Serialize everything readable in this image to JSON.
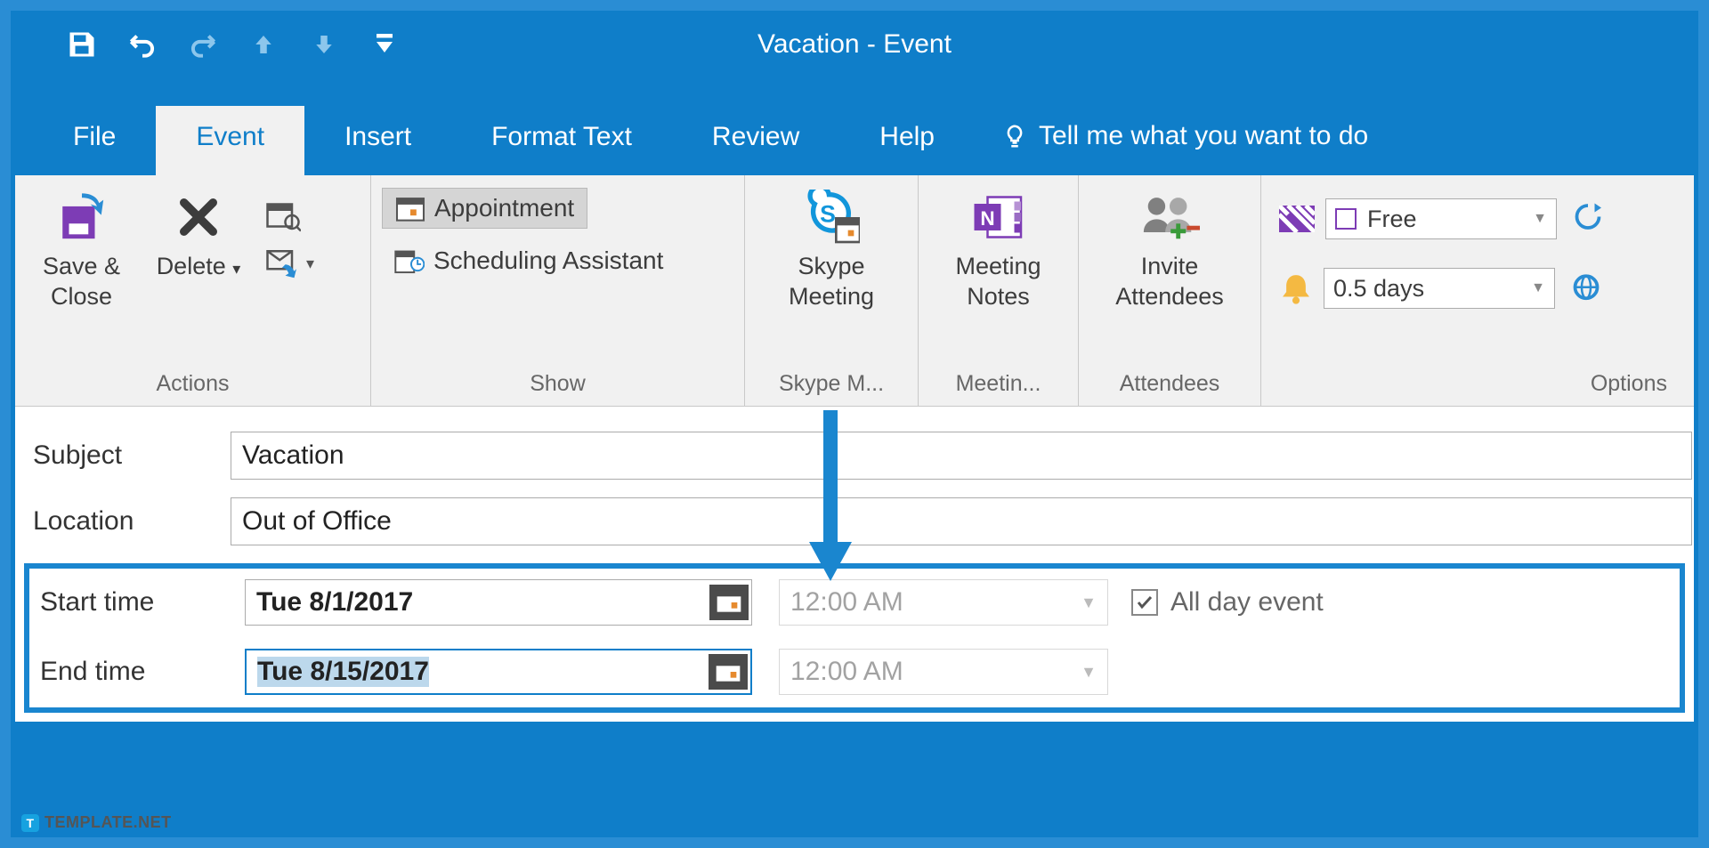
{
  "window": {
    "title": "Vacation  -  Event"
  },
  "tabs": {
    "file": "File",
    "event": "Event",
    "insert": "Insert",
    "format": "Format Text",
    "review": "Review",
    "help": "Help",
    "tellme": "Tell me what you want to do"
  },
  "ribbon": {
    "actions": {
      "label": "Actions",
      "save_close": "Save & Close",
      "delete": "Delete"
    },
    "show": {
      "label": "Show",
      "appointment": "Appointment",
      "scheduling": "Scheduling Assistant"
    },
    "skype": {
      "group_label": "Skype M...",
      "btn": "Skype Meeting"
    },
    "meeting_notes": {
      "group_label": "Meetin...",
      "btn": "Meeting Notes"
    },
    "attendees": {
      "group_label": "Attendees",
      "btn": "Invite Attendees"
    },
    "options": {
      "group_label": "Options",
      "showas": "Free",
      "reminder": "0.5 days"
    }
  },
  "form": {
    "subject_label": "Subject",
    "subject_value": "Vacation",
    "location_label": "Location",
    "location_value": "Out of Office",
    "start_label": "Start time",
    "start_date": "Tue 8/1/2017",
    "start_time": "12:00 AM",
    "end_label": "End time",
    "end_date": "Tue 8/15/2017",
    "end_time": "12:00 AM",
    "allday": "All day event"
  },
  "watermark": "TEMPLATE.NET"
}
